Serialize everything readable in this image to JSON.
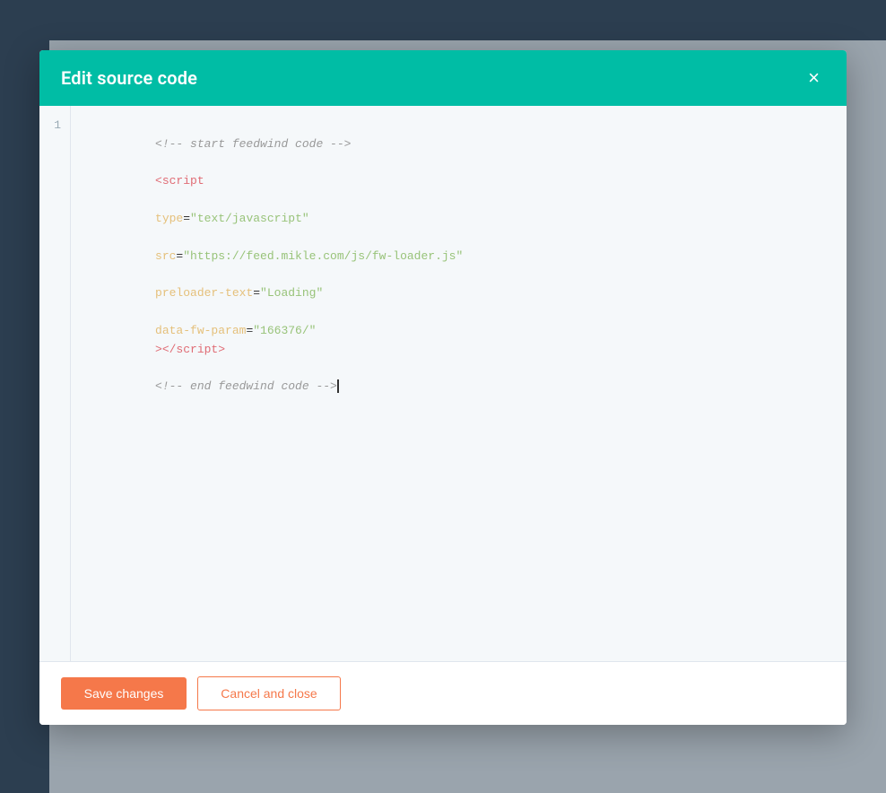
{
  "modal": {
    "title": "Edit source code",
    "close_icon": "×",
    "code_line_number": "1",
    "code_content_comment_start": "<!-- start feedwind code -->",
    "code_content_tag_open": "<script",
    "code_content_attr1_name": "type",
    "code_content_attr1_eq": "=",
    "code_content_attr1_val": "\"text/javascript\"",
    "code_content_attr2_name": "src",
    "code_content_attr2_eq": "=",
    "code_content_attr2_val": "\"https://feed.mikle.com/js/fw-loader.js\"",
    "code_content_attr3_name": "preloader-text",
    "code_content_attr3_eq": "=",
    "code_content_attr3_val": "\"Loading\"",
    "code_content_attr4_name": "data-fw-param",
    "code_content_attr4_eq": "=",
    "code_content_attr4_val": "\"166376/\"",
    "code_content_tag_close": "></",
    "code_content_tag_name_close": "script",
    "code_content_tag_end": ">",
    "code_content_comment_end": "<!-- end feedwind code -->",
    "footer": {
      "save_label": "Save changes",
      "cancel_label": "Cancel and close"
    }
  }
}
